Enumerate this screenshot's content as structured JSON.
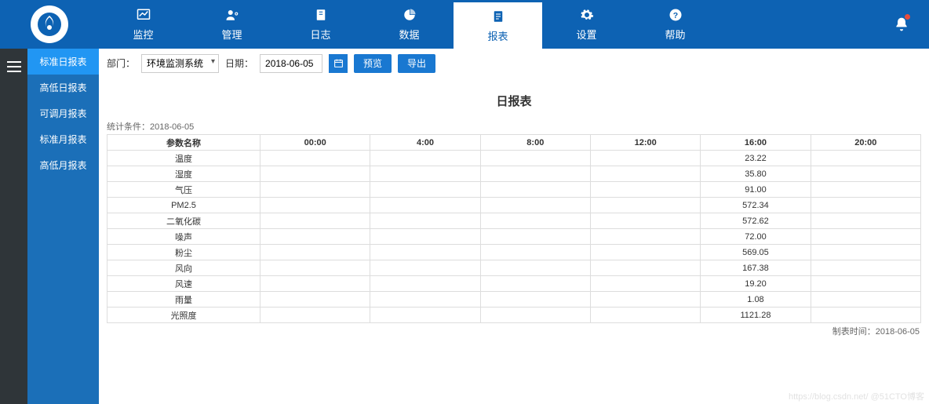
{
  "nav": {
    "items": [
      {
        "label": "监控",
        "icon": "chart-line-icon"
      },
      {
        "label": "管理",
        "icon": "user-cog-icon"
      },
      {
        "label": "日志",
        "icon": "book-icon"
      },
      {
        "label": "数据",
        "icon": "pie-chart-icon"
      },
      {
        "label": "报表",
        "icon": "report-icon",
        "active": true
      },
      {
        "label": "设置",
        "icon": "gear-icon"
      },
      {
        "label": "帮助",
        "icon": "help-icon"
      }
    ]
  },
  "sidebar": {
    "items": [
      {
        "label": "标准日报表",
        "active": true
      },
      {
        "label": "高低日报表"
      },
      {
        "label": "可调月报表"
      },
      {
        "label": "标准月报表"
      },
      {
        "label": "高低月报表"
      }
    ]
  },
  "toolbar": {
    "dept_label": "部门：",
    "dept_value": "环境监测系统",
    "date_label": "日期：",
    "date_value": "2018-06-05",
    "preview_label": "预览",
    "export_label": "导出"
  },
  "report": {
    "title": "日报表",
    "stats_prefix": "统计条件：",
    "stats_value": "2018-06-05",
    "header_param": "参数名称",
    "time_headers": [
      "00:00",
      "4:00",
      "8:00",
      "12:00",
      "16:00",
      "20:00"
    ],
    "rows": [
      {
        "name": "温度",
        "vals": [
          "",
          "",
          "",
          "",
          "23.22",
          ""
        ]
      },
      {
        "name": "湿度",
        "vals": [
          "",
          "",
          "",
          "",
          "35.80",
          ""
        ]
      },
      {
        "name": "气压",
        "vals": [
          "",
          "",
          "",
          "",
          "91.00",
          ""
        ]
      },
      {
        "name": "PM2.5",
        "vals": [
          "",
          "",
          "",
          "",
          "572.34",
          ""
        ]
      },
      {
        "name": "二氧化碳",
        "vals": [
          "",
          "",
          "",
          "",
          "572.62",
          ""
        ]
      },
      {
        "name": "噪声",
        "vals": [
          "",
          "",
          "",
          "",
          "72.00",
          ""
        ]
      },
      {
        "name": "粉尘",
        "vals": [
          "",
          "",
          "",
          "",
          "569.05",
          ""
        ]
      },
      {
        "name": "风向",
        "vals": [
          "",
          "",
          "",
          "",
          "167.38",
          ""
        ]
      },
      {
        "name": "风速",
        "vals": [
          "",
          "",
          "",
          "",
          "19.20",
          ""
        ]
      },
      {
        "name": "雨量",
        "vals": [
          "",
          "",
          "",
          "",
          "1.08",
          ""
        ]
      },
      {
        "name": "光照度",
        "vals": [
          "",
          "",
          "",
          "",
          "1121.28",
          ""
        ]
      }
    ],
    "footer_prefix": "制表时间：",
    "footer_value": "2018-06-05"
  },
  "watermark": "https://blog.csdn.net/   @51CTO博客"
}
